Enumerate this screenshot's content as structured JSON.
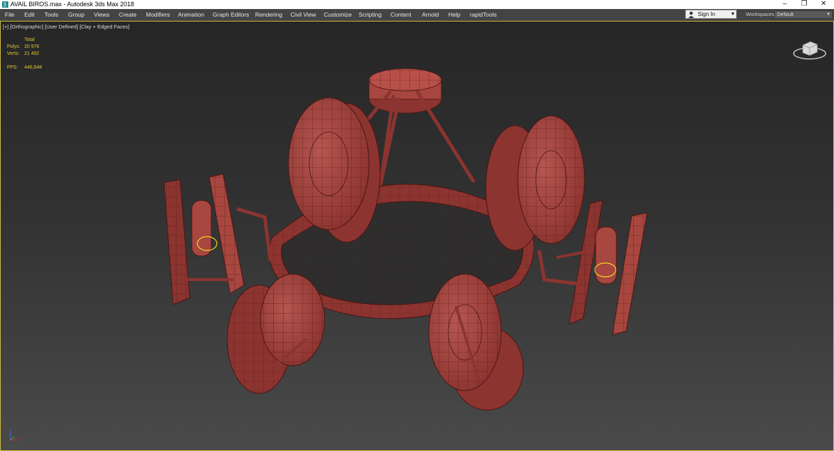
{
  "window": {
    "title": "AVAIL BIROS.max - Autodesk 3ds Max 2018",
    "minimize": "–",
    "maximize": "❐",
    "close": "✕"
  },
  "menu": {
    "items": [
      "File",
      "Edit",
      "Tools",
      "Group",
      "Views",
      "Create",
      "Modifiers",
      "Animation",
      "Graph Editors",
      "Rendering",
      "Civil View",
      "Customize",
      "Scripting",
      "Content",
      "Arnold",
      "Help",
      "rapidTools"
    ]
  },
  "account": {
    "signin_label": "Sign In",
    "caret": "▼"
  },
  "workspaces": {
    "label": "Workspaces:",
    "value": "Default",
    "caret": "▼"
  },
  "viewport": {
    "plus": "[+]",
    "view": "[Orthographic]",
    "style": "[User Defined]",
    "shading": "[Clay + Edged Faces]"
  },
  "stats": {
    "header": "Total",
    "polys_label": "Polys:",
    "polys": "20 976",
    "verts_label": "Verts:",
    "verts": "21 492",
    "fps_label": "FPS:",
    "fps": "446,648"
  },
  "colors": {
    "clay": "#a84640",
    "edge": "#4a1512",
    "viewport_border": "#d6c23c",
    "stats_text": "#e0c830",
    "selection": "#f0e020"
  },
  "icons": {
    "app": "3ds-max-icon",
    "user": "user-icon",
    "viewcube": "viewcube-icon",
    "axis": "axis-tripod-icon"
  }
}
